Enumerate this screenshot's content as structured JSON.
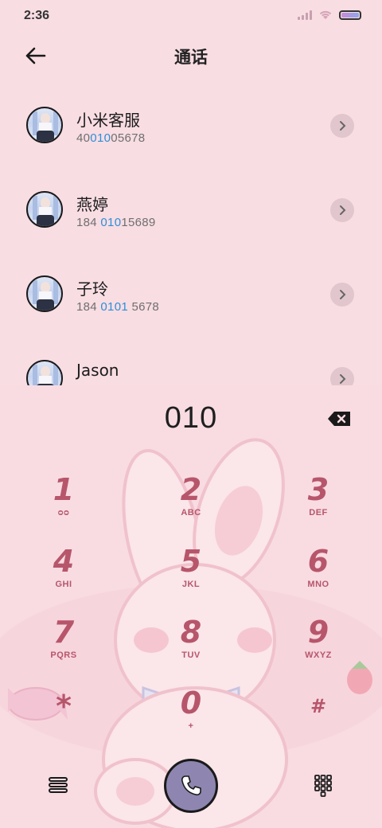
{
  "status_bar": {
    "time": "2:36"
  },
  "header": {
    "title": "通话"
  },
  "contacts": [
    {
      "name": "小米客服",
      "number_pre": "40",
      "number_hl": "010",
      "number_post": "05678"
    },
    {
      "name": "燕婷",
      "number_pre": "184 ",
      "number_hl": "010",
      "number_post": "15689"
    },
    {
      "name": "子玲",
      "number_pre": "184 ",
      "number_hl": "0101",
      "number_post": " 5678"
    },
    {
      "name": "Jason",
      "number_pre": "",
      "number_hl": "",
      "number_post": ""
    }
  ],
  "dialer": {
    "input": "010",
    "keys": [
      {
        "digit": "1",
        "letters": "ᴑᴑ"
      },
      {
        "digit": "2",
        "letters": "ABC"
      },
      {
        "digit": "3",
        "letters": "DEF"
      },
      {
        "digit": "4",
        "letters": "GHI"
      },
      {
        "digit": "5",
        "letters": "JKL"
      },
      {
        "digit": "6",
        "letters": "MNO"
      },
      {
        "digit": "7",
        "letters": "PQRS"
      },
      {
        "digit": "8",
        "letters": "TUV"
      },
      {
        "digit": "9",
        "letters": "WXYZ"
      },
      {
        "digit": "*",
        "letters": ""
      },
      {
        "digit": "0",
        "letters": "+"
      },
      {
        "digit": "#",
        "letters": ""
      }
    ]
  },
  "icons": {
    "back": "back-arrow-icon",
    "chevron": "chevron-right-icon",
    "backspace": "backspace-icon",
    "call": "phone-icon",
    "menu": "menu-icon",
    "keypad": "keypad-icon"
  },
  "colors": {
    "background": "#f8dde3",
    "key_text": "#b7566b",
    "highlight": "#2d8fd8",
    "call_button": "#8e86b0"
  }
}
